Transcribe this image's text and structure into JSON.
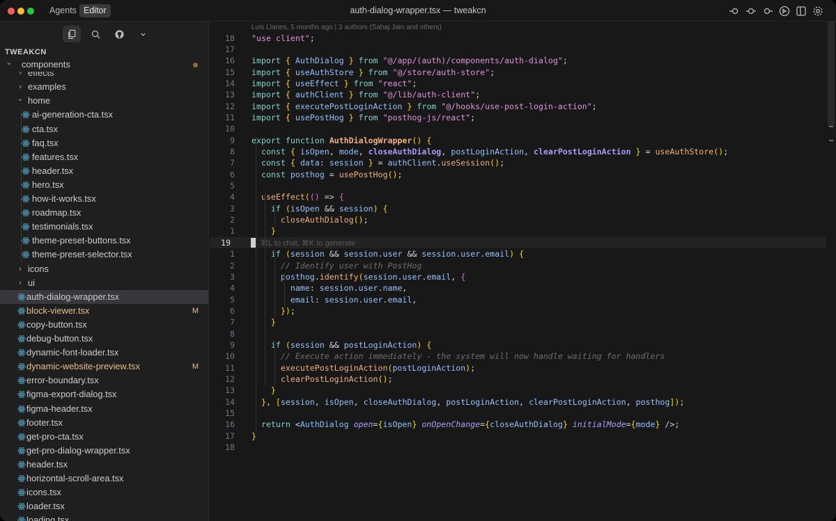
{
  "window": {
    "title": "auth-dialog-wrapper.tsx — tweakcn",
    "modes": [
      "Agents",
      "Editor"
    ],
    "active_mode": "Editor"
  },
  "titlebar_icons": [
    "toggle-left-icon",
    "toggle-center-icon",
    "toggle-right-icon",
    "cursor-logo-icon",
    "split-panel-icon",
    "settings-icon"
  ],
  "sidebar": {
    "actions": [
      "files-icon",
      "search-icon",
      "github-icon",
      "chevron-down-icon"
    ],
    "section_title": "TWEAKCN",
    "tree": [
      {
        "label": "components",
        "type": "folder",
        "open": true,
        "depth": 0,
        "dot": true
      },
      {
        "label": "effects",
        "type": "folder",
        "open": false,
        "depth": 1
      },
      {
        "label": "examples",
        "type": "folder",
        "open": false,
        "depth": 1
      },
      {
        "label": "home",
        "type": "folder",
        "open": true,
        "depth": 1
      },
      {
        "label": "ai-generation-cta.tsx",
        "type": "file",
        "depth": 2
      },
      {
        "label": "cta.tsx",
        "type": "file",
        "depth": 2
      },
      {
        "label": "faq.tsx",
        "type": "file",
        "depth": 2
      },
      {
        "label": "features.tsx",
        "type": "file",
        "depth": 2
      },
      {
        "label": "header.tsx",
        "type": "file",
        "depth": 2
      },
      {
        "label": "hero.tsx",
        "type": "file",
        "depth": 2
      },
      {
        "label": "how-it-works.tsx",
        "type": "file",
        "depth": 2
      },
      {
        "label": "roadmap.tsx",
        "type": "file",
        "depth": 2
      },
      {
        "label": "testimonials.tsx",
        "type": "file",
        "depth": 2
      },
      {
        "label": "theme-preset-buttons.tsx",
        "type": "file",
        "depth": 2
      },
      {
        "label": "theme-preset-selector.tsx",
        "type": "file",
        "depth": 2
      },
      {
        "label": "icons",
        "type": "folder",
        "open": false,
        "depth": 1
      },
      {
        "label": "ui",
        "type": "folder",
        "open": false,
        "depth": 1
      },
      {
        "label": "auth-dialog-wrapper.tsx",
        "type": "file",
        "depth": 1,
        "selected": true
      },
      {
        "label": "block-viewer.tsx",
        "type": "file",
        "depth": 1,
        "status": "M"
      },
      {
        "label": "copy-button.tsx",
        "type": "file",
        "depth": 1
      },
      {
        "label": "debug-button.tsx",
        "type": "file",
        "depth": 1
      },
      {
        "label": "dynamic-font-loader.tsx",
        "type": "file",
        "depth": 1
      },
      {
        "label": "dynamic-website-preview.tsx",
        "type": "file",
        "depth": 1,
        "status": "M"
      },
      {
        "label": "error-boundary.tsx",
        "type": "file",
        "depth": 1
      },
      {
        "label": "figma-export-dialog.tsx",
        "type": "file",
        "depth": 1
      },
      {
        "label": "figma-header.tsx",
        "type": "file",
        "depth": 1
      },
      {
        "label": "footer.tsx",
        "type": "file",
        "depth": 1
      },
      {
        "label": "get-pro-cta.tsx",
        "type": "file",
        "depth": 1
      },
      {
        "label": "get-pro-dialog-wrapper.tsx",
        "type": "file",
        "depth": 1
      },
      {
        "label": "header.tsx",
        "type": "file",
        "depth": 1
      },
      {
        "label": "horizontal-scroll-area.tsx",
        "type": "file",
        "depth": 1
      },
      {
        "label": "icons.tsx",
        "type": "file",
        "depth": 1
      },
      {
        "label": "loader.tsx",
        "type": "file",
        "depth": 1
      },
      {
        "label": "loading.tsx",
        "type": "file",
        "depth": 1
      }
    ]
  },
  "editor": {
    "blame": "Luis Llanes, 5 months ago | 3 authors (Sahaj Jain and others)",
    "cursor_hint": "⌘L to chat, ⌘K to generate",
    "lines": [
      {
        "n": "18",
        "code": "\"use client\";"
      },
      {
        "n": "17",
        "code": ""
      },
      {
        "n": "16",
        "code": "import { AuthDialog } from \"@/app/(auth)/components/auth-dialog\";"
      },
      {
        "n": "15",
        "code": "import { useAuthStore } from \"@/store/auth-store\";"
      },
      {
        "n": "14",
        "code": "import { useEffect } from \"react\";"
      },
      {
        "n": "13",
        "code": "import { authClient } from \"@/lib/auth-client\";"
      },
      {
        "n": "12",
        "code": "import { executePostLoginAction } from \"@/hooks/use-post-login-action\";"
      },
      {
        "n": "11",
        "code": "import { usePostHog } from \"posthog-js/react\";"
      },
      {
        "n": "10",
        "code": ""
      },
      {
        "n": "9",
        "code": "export function AuthDialogWrapper() {"
      },
      {
        "n": "8",
        "code": "  const { isOpen, mode, closeAuthDialog, postLoginAction, clearPostLoginAction } = useAuthStore();"
      },
      {
        "n": "7",
        "code": "  const { data: session } = authClient.useSession();"
      },
      {
        "n": "6",
        "code": "  const posthog = usePostHog();"
      },
      {
        "n": "5",
        "code": ""
      },
      {
        "n": "4",
        "code": "  useEffect(() => {"
      },
      {
        "n": "3",
        "code": "    if (isOpen && session) {"
      },
      {
        "n": "2",
        "code": "      closeAuthDialog();"
      },
      {
        "n": "1",
        "code": "    }"
      },
      {
        "n": "19",
        "code": "",
        "cursor": true
      },
      {
        "n": "1",
        "code": "    if (session && session.user && session.user.email) {"
      },
      {
        "n": "2",
        "code": "      // Identify user with PostHog"
      },
      {
        "n": "3",
        "code": "      posthog.identify(session.user.email, {"
      },
      {
        "n": "4",
        "code": "        name: session.user.name,"
      },
      {
        "n": "5",
        "code": "        email: session.user.email,"
      },
      {
        "n": "6",
        "code": "      });"
      },
      {
        "n": "7",
        "code": "    }"
      },
      {
        "n": "8",
        "code": ""
      },
      {
        "n": "9",
        "code": "    if (session && postLoginAction) {"
      },
      {
        "n": "10",
        "code": "      // Execute action immediately - the system will now handle waiting for handlers"
      },
      {
        "n": "11",
        "code": "      executePostLoginAction(postLoginAction);"
      },
      {
        "n": "12",
        "code": "      clearPostLoginAction();"
      },
      {
        "n": "13",
        "code": "    }"
      },
      {
        "n": "14",
        "code": "  }, [session, isOpen, closeAuthDialog, postLoginAction, clearPostLoginAction, posthog]);"
      },
      {
        "n": "15",
        "code": ""
      },
      {
        "n": "16",
        "code": "  return <AuthDialog open={isOpen} onOpenChange={closeAuthDialog} initialMode={mode} />;"
      },
      {
        "n": "17",
        "code": "}"
      },
      {
        "n": "18",
        "code": ""
      }
    ]
  },
  "colors": {
    "window_bg": "#181818",
    "sidebar_bg": "#1f1f1f",
    "selected_row": "#37373d",
    "modified": "#e2c08d",
    "tsx_icon": "#519aba"
  }
}
